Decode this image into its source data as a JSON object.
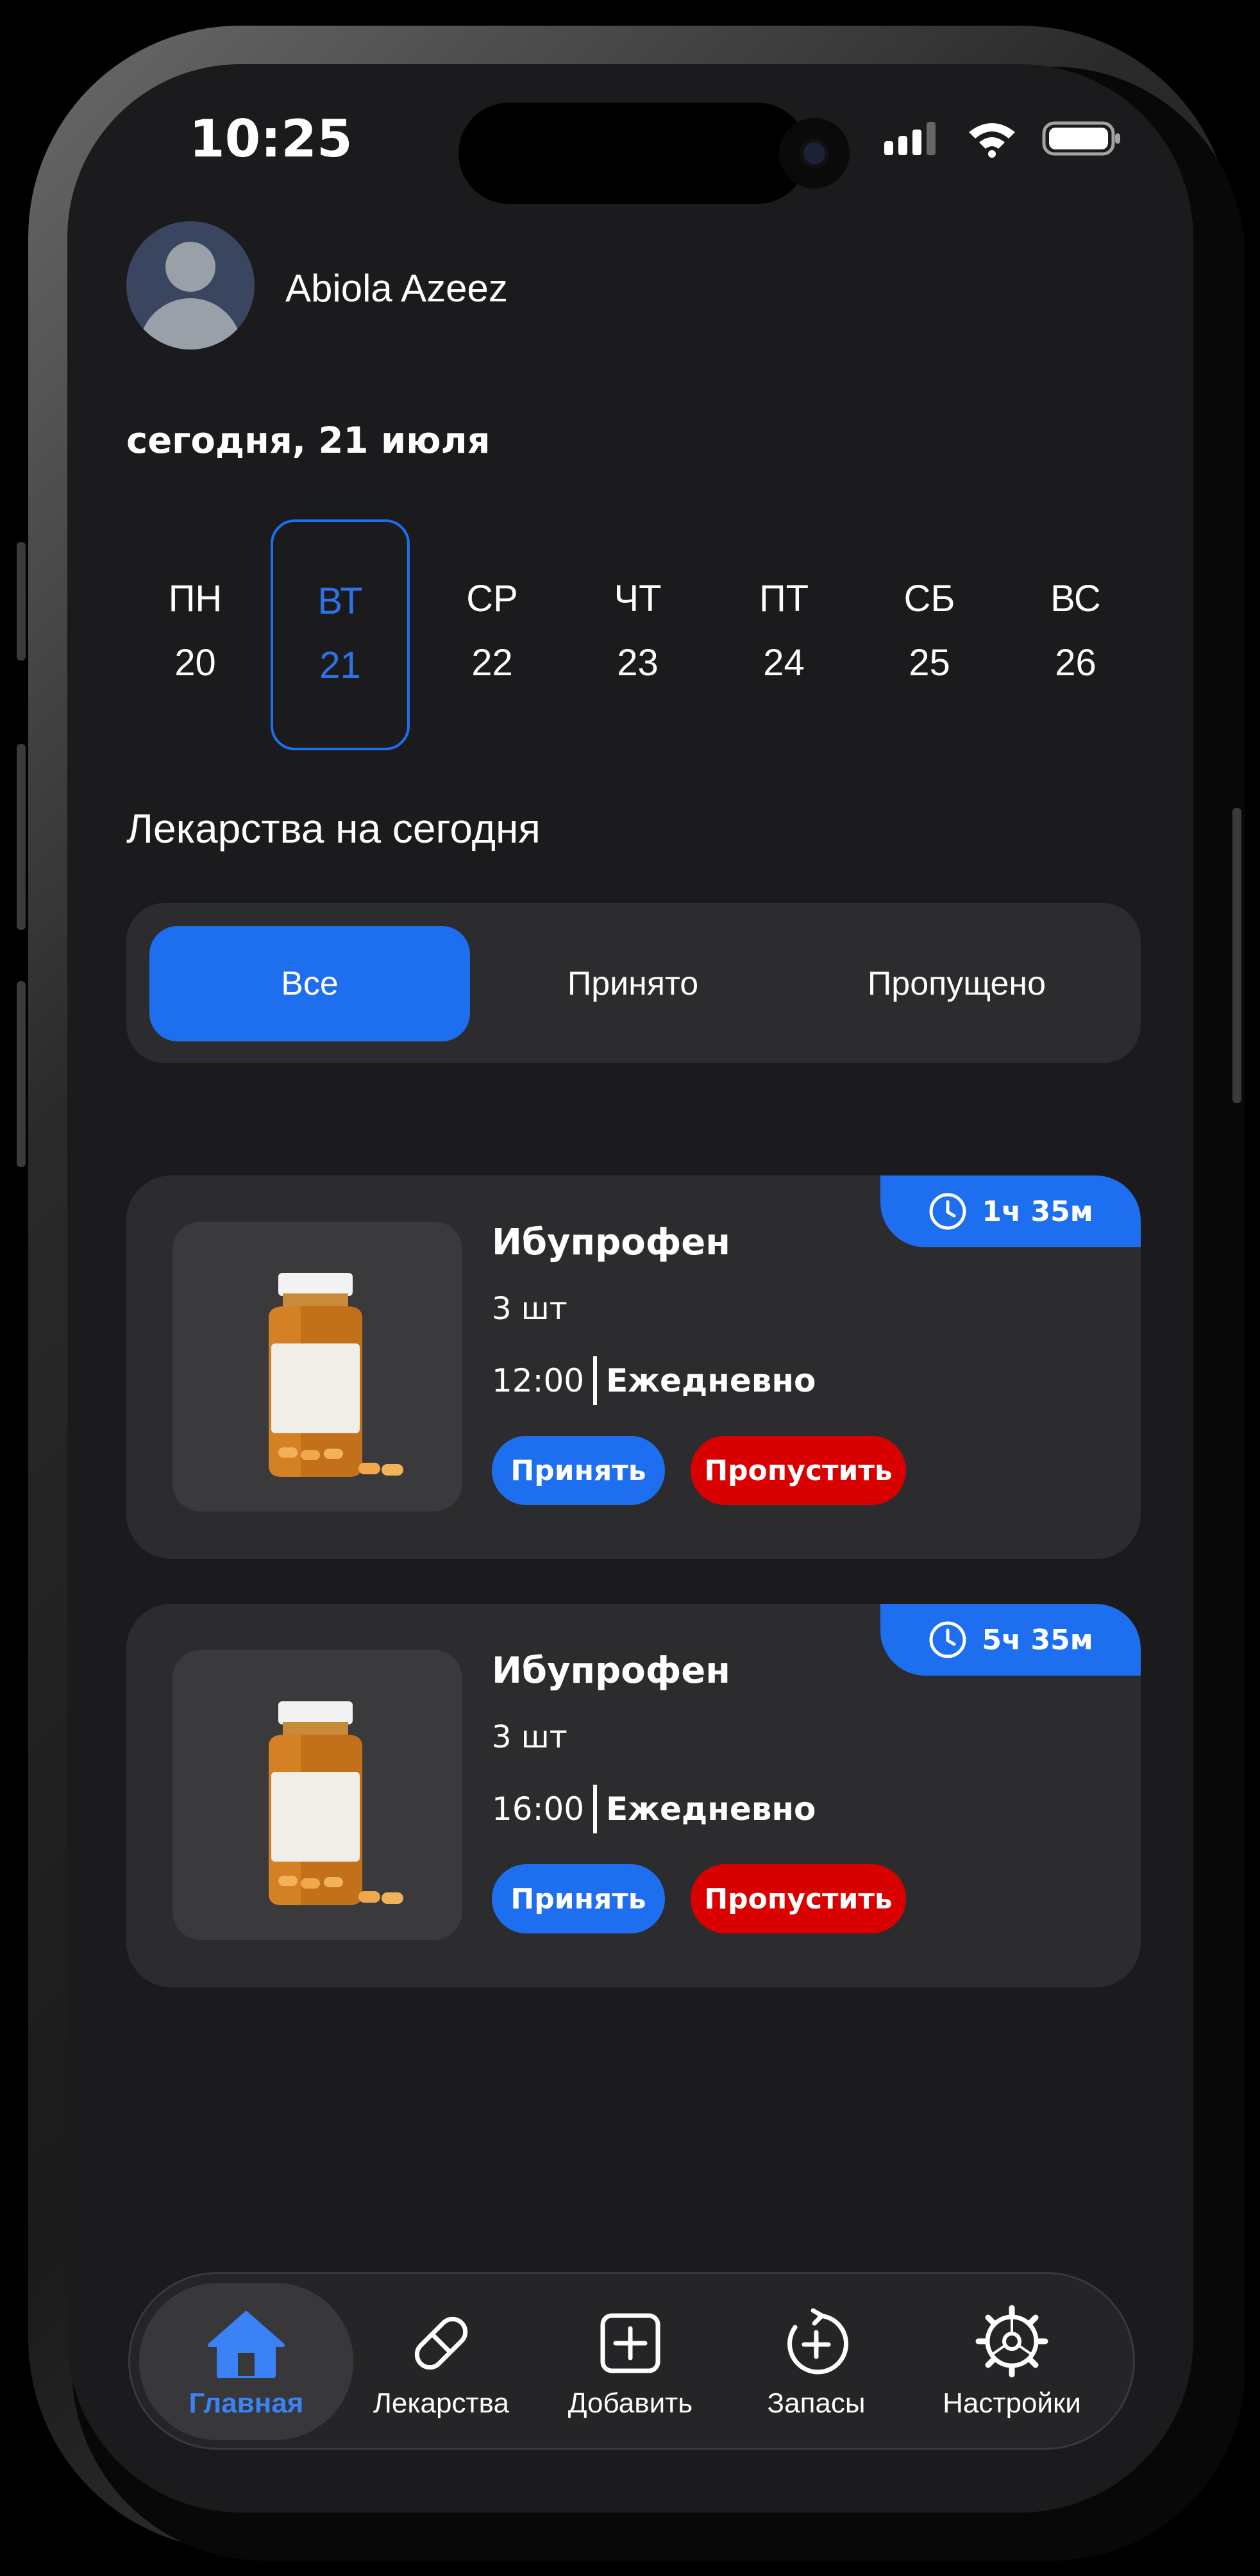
{
  "status": {
    "time": "10:25"
  },
  "user": {
    "name": "Abiola Azeez"
  },
  "date_title": "сегодня, 21 июля",
  "week": [
    {
      "weekday": "ПН",
      "day": "20"
    },
    {
      "weekday": "ВТ",
      "day": "21",
      "active": true
    },
    {
      "weekday": "СР",
      "day": "22"
    },
    {
      "weekday": "ЧТ",
      "day": "23"
    },
    {
      "weekday": "ПТ",
      "day": "24"
    },
    {
      "weekday": "СБ",
      "day": "25"
    },
    {
      "weekday": "ВС",
      "day": "26"
    }
  ],
  "section_title": "Лекарства на сегодня",
  "filters": [
    "Все",
    "Принято",
    "Пропущено"
  ],
  "active_filter": "Все",
  "meds": [
    {
      "timer": "1ч 35м",
      "name": "Ибупрофен",
      "qty": "3 шт",
      "time": "12:00",
      "frequency": "Ежедневно",
      "take_label": "Принять",
      "skip_label": "Пропустить"
    },
    {
      "timer": "5ч 35м",
      "name": "Ибупрофен",
      "qty": "3 шт",
      "time": "16:00",
      "frequency": "Ежедневно",
      "take_label": "Принять",
      "skip_label": "Пропустить"
    }
  ],
  "tabs": [
    {
      "label": "Главная",
      "icon": "home-icon",
      "active": true
    },
    {
      "label": "Лекарства",
      "icon": "pill-icon"
    },
    {
      "label": "Добавить",
      "icon": "plus-square-icon"
    },
    {
      "label": "Запасы",
      "icon": "refresh-plus-icon"
    },
    {
      "label": "Настройки",
      "icon": "gear-icon"
    }
  ],
  "colors": {
    "accent": "#1e6ef0",
    "danger": "#d90000",
    "background": "#1b1b1d",
    "card": "#2c2c2e"
  }
}
